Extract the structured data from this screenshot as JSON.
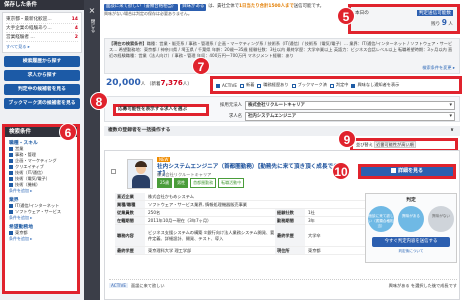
{
  "sidebar": {
    "saved_title": "保存した条件",
    "saved": [
      {
        "label": "東京都・最新化歓迎...",
        "count": "14"
      },
      {
        "label": "大手企業の経験あり...",
        "count": "4"
      },
      {
        "label": "営業経験者 ...",
        "count": "2"
      }
    ],
    "saved_more": "すべて見る ▸",
    "buttons": [
      "検索履歴から探す",
      "求人から探す",
      "判定中の候補者を見る",
      "ブックマーク済の候補者を見る"
    ],
    "criteria_title": "検索条件",
    "criteria": {
      "heading1": "職種・スキル",
      "items1": [
        {
          "text": "営業",
          "on": true
        },
        {
          "text": "事務・管理",
          "on": true
        },
        {
          "text": "企画・マーケティング",
          "on": true
        },
        {
          "text": "クリエイティブ",
          "on": true
        },
        {
          "text": "技術（IT/通信）",
          "on": true
        },
        {
          "text": "技術（電気/電子）",
          "on": true
        },
        {
          "text": "技術（機械）",
          "on": true
        }
      ],
      "more": "条件を追加 ▸",
      "heading2": "業界",
      "items2": [
        {
          "text": "IT/通信/インターネット",
          "on": true
        },
        {
          "text": "ソフトウェア・サービス",
          "on": true
        }
      ],
      "heading3": "希望勤務地",
      "items3": [
        {
          "text": "東京都",
          "on": true
        }
      ]
    }
  },
  "close_strip": {
    "icon": "×",
    "label": "閉じる"
  },
  "notice": {
    "pill1": "面談に来て欲しい（書類合格相当）",
    "pill2": "興味がある",
    "text1": "は、貴社全体で",
    "highlight": "1日当たり合計1500人まで",
    "text2": "送信可能です。",
    "small": "興味がない場合は判定の保存は必要ありません。"
  },
  "quota": {
    "today": "本日の",
    "label": "判定送信可能数",
    "remain_label": "残り",
    "remain": "9",
    "unit": "人"
  },
  "conditions": {
    "head": "【現在の検索条件】",
    "text": "職種：営業・販売系 / 事務・管理系 / 企画・マーケティング系 / 技術系（IT/通信）/ 技術系（電気/電子）… 業界：IT/通信/インターネット / ソフトウェア・サービス… 希望勤務地：東京都 / 神奈川県 / 埼玉県 / 千葉県 年齢：20歳〜35歳 経験社数：3社以内 最終学歴：大学卒業以上 英語力：ビジネス会話レベル以上 転職希望時期：3ヶ月以内 直近の経験職種：営業（法人向け）/ 事務・管理 年収：400万円〜700万円 マネジメント経験：あり",
    "edit": "検索条件を変更 ▸"
  },
  "result": {
    "count": "20,000",
    "unit": "人",
    "new_label": "新着",
    "new_count": "7,376",
    "new_unit": "人"
  },
  "filters": [
    {
      "label": "ACTIVE",
      "on": true
    },
    {
      "label": "新着",
      "on": false
    },
    {
      "label": "職務経歴あり",
      "on": false
    },
    {
      "label": "ブックマーク済",
      "on": false
    },
    {
      "label": "判定中",
      "on": false
    },
    {
      "label": "興味なし通知者を表示",
      "on": true
    }
  ],
  "select_area": {
    "label": "応募可能性を表示する求人を選ぶ",
    "company_label": "採用元法人",
    "company_value": "株式会社リクルートキャリア",
    "job_label": "求人名",
    "job_value": "社内システムエンジニア"
  },
  "bulk": {
    "label": "複数の登録者を一括操作する",
    "chev": "∨"
  },
  "lastlogin": {
    "label": "並び替え",
    "value": "近番可能性が高い順"
  },
  "card": {
    "new_badge": "NEW",
    "title": "社内システムエンジニア（首都圏勤務）【勤務先に来て頂き頂く成長できます】",
    "sub": "株式会社リクルートキャリア",
    "tags": [
      "25歳",
      "男性",
      "首都圏勤務",
      "転職活動中"
    ],
    "detail_btn": "詳細を見る",
    "rows": [
      {
        "k": "直近企業",
        "v": "株式会社かもめシステム",
        "k2": "",
        "v2": ""
      },
      {
        "k": "業種/職種",
        "v": "ソフトウェア・サービス業界, 情報処理機器販売事業",
        "k2": "",
        "v2": ""
      },
      {
        "k": "従業員数",
        "v": "250名",
        "k2": "経験社数",
        "v2": "1社"
      },
      {
        "k": "在籍期間",
        "v": "2011年10月〜現在（3年7ヶ月）",
        "k2": "勤務期間",
        "v2": "3年"
      },
      {
        "k": "職務内容",
        "v": "ビジネス支援システムの構築 ①銀行向け法人業務システム開発、要件定義、詳細設計、開発、テスト、導入",
        "k2": "最終学歴",
        "v2": "大学卒"
      },
      {
        "k": "最終学歴",
        "v": "東京理科大学 理工学部",
        "k2": "現住所",
        "v2": "東京都"
      }
    ],
    "judge": {
      "head": "判定",
      "c1": "面談に来て欲しい（書類合格相当）",
      "c2": "興味がある",
      "c3": "興味がない",
      "btn": "今すぐ判定内容を送信する",
      "note": "判定後について"
    },
    "foot_left_tag": "ACTIVE",
    "foot_left": "面談に来て欲しい",
    "foot_right": "興味がある を選択した後で成長です"
  },
  "badges": [
    "5",
    "6",
    "7",
    "8",
    "9",
    "10"
  ]
}
